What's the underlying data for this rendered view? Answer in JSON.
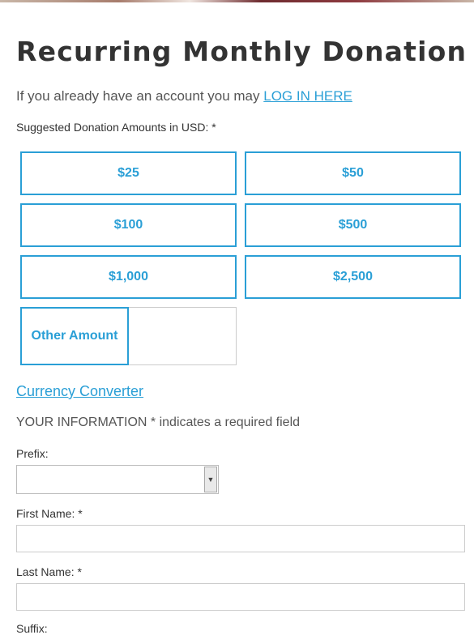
{
  "page": {
    "title": "Recurring Monthly Donation",
    "login_prompt": "If you already have an account you may",
    "login_link": "LOG IN HERE",
    "suggested_label": "Suggested Donation Amounts in USD: *"
  },
  "amounts": [
    "$25",
    "$50",
    "$100",
    "$500",
    "$1,000",
    "$2,500"
  ],
  "other_amount": {
    "label": "Other Amount",
    "value": ""
  },
  "currency_converter": "Currency Converter",
  "your_information": "YOUR INFORMATION * indicates a required field",
  "fields": {
    "prefix_label": "Prefix:",
    "prefix_value": "",
    "first_name_label": "First Name: *",
    "first_name_value": "",
    "last_name_label": "Last Name: *",
    "last_name_value": "",
    "suffix_label": "Suffix:"
  },
  "colors": {
    "accent": "#2a9fd6",
    "text": "#333333",
    "muted_text": "#555555"
  }
}
